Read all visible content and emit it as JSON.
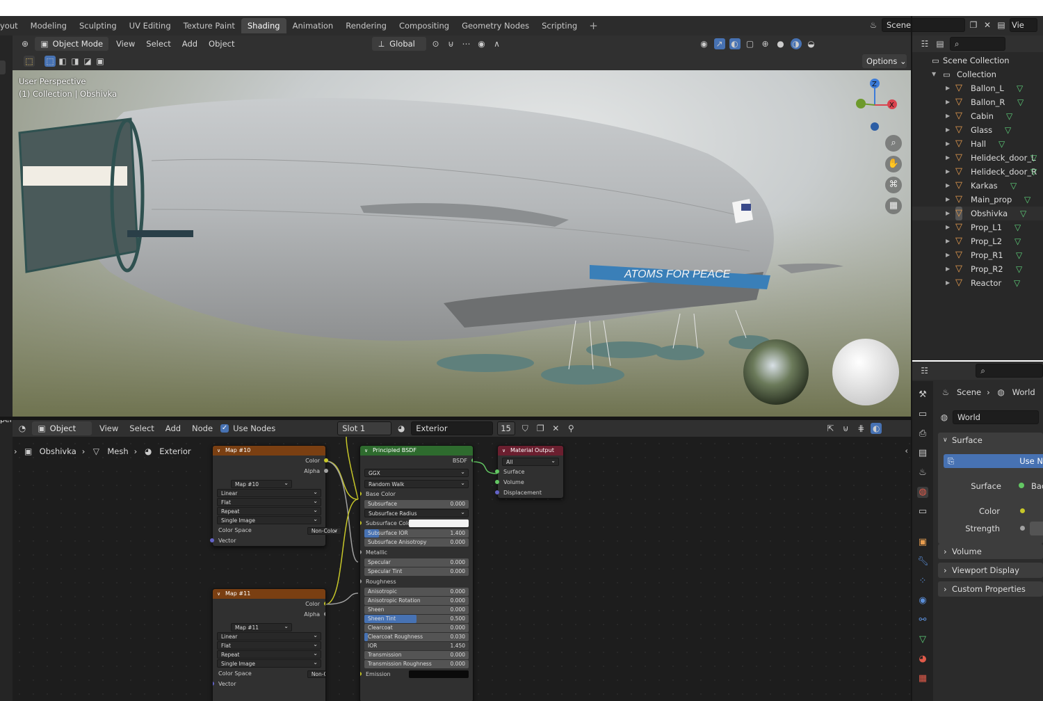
{
  "workspace_tabs": [
    "yout",
    "Modeling",
    "Sculpting",
    "UV Editing",
    "Texture Paint",
    "Shading",
    "Animation",
    "Rendering",
    "Compositing",
    "Geometry Nodes",
    "Scripting"
  ],
  "active_tab": "Shading",
  "scene": {
    "name": "Scene",
    "view_layer": "Vie"
  },
  "viewport": {
    "mode": "Object Mode",
    "menus": [
      "View",
      "Select",
      "Add",
      "Object"
    ],
    "transform_orientation": "Global",
    "options_label": "Options",
    "overlay_line1": "User Perspective",
    "overlay_line2": "(1) Collection | Obshivka",
    "gizmo": {
      "z": "Z",
      "x": "X"
    },
    "decal_text": "ATOMS FOR PEACE"
  },
  "node_editor": {
    "type": "Object",
    "menus": [
      "View",
      "Select",
      "Add",
      "Node"
    ],
    "use_nodes_label": "Use Nodes",
    "slot": "Slot 1",
    "material": "Exterior",
    "user_count": "15",
    "breadcrumb": [
      "Obshivka",
      "Mesh",
      "Exterior"
    ],
    "left_cut": "per"
  },
  "nodes": {
    "map10": {
      "title": "Map #10",
      "out_color": "Color",
      "out_alpha": "Alpha",
      "image": "Map #10",
      "interp": "Linear",
      "proj": "Flat",
      "ext": "Repeat",
      "source": "Single Image",
      "cs_label": "Color Space",
      "cs_value": "Non-Color",
      "in_vector": "Vector"
    },
    "map11": {
      "title": "Map #11",
      "out_color": "Color",
      "out_alpha": "Alpha",
      "image": "Map #11",
      "interp": "Linear",
      "proj": "Flat",
      "ext": "Repeat",
      "source": "Single Image",
      "cs_label": "Color Space",
      "cs_value": "Non-Color",
      "in_vector": "Vector"
    },
    "bsdf": {
      "title": "Principled BSDF",
      "out": "BSDF",
      "dist": "GGX",
      "sss_method": "Random Walk",
      "base_color": "Base Color",
      "subsurface": {
        "label": "Subsurface",
        "value": "0.000"
      },
      "subsurface_radius": "Subsurface Radius",
      "subsurface_color": "Subsurface Color",
      "subsurface_ior": {
        "label": "Subsurface IOR",
        "value": "1.400"
      },
      "subsurface_aniso": {
        "label": "Subsurface Anisotropy",
        "value": "0.000"
      },
      "metallic": "Metallic",
      "specular": {
        "label": "Specular",
        "value": "0.000"
      },
      "specular_tint": {
        "label": "Specular Tint",
        "value": "0.000"
      },
      "roughness": "Roughness",
      "anisotropic": {
        "label": "Anisotropic",
        "value": "0.000"
      },
      "aniso_rot": {
        "label": "Anisotropic Rotation",
        "value": "0.000"
      },
      "sheen": {
        "label": "Sheen",
        "value": "0.000"
      },
      "sheen_tint": {
        "label": "Sheen Tint",
        "value": "0.500",
        "fill": 0.5
      },
      "clearcoat": {
        "label": "Clearcoat",
        "value": "0.000"
      },
      "clearcoat_rough": {
        "label": "Clearcoat Roughness",
        "value": "0.030",
        "fill": 0.03
      },
      "ior": {
        "label": "IOR",
        "value": "1.450"
      },
      "transmission": {
        "label": "Transmission",
        "value": "0.000"
      },
      "transmission_rough": {
        "label": "Transmission Roughness",
        "value": "0.000"
      },
      "emission": "Emission"
    },
    "output": {
      "title": "Material Output",
      "target": "All",
      "surface": "Surface",
      "volume": "Volume",
      "displacement": "Displacement"
    }
  },
  "outliner": {
    "root": "Scene Collection",
    "collection": "Collection",
    "items": [
      "Ballon_L",
      "Ballon_R",
      "Cabin",
      "Glass",
      "Hall",
      "Helideck_door_L",
      "Helideck_door_R",
      "Karkas",
      "Main_prop",
      "Obshivka",
      "Prop_L1",
      "Prop_L2",
      "Prop_R1",
      "Prop_R2",
      "Reactor"
    ],
    "active_item": "Obshivka"
  },
  "properties": {
    "breadcrumb": [
      "Scene",
      "World"
    ],
    "world_name": "World",
    "surface_panel": "Surface",
    "use_nodes_btn": "Use N",
    "surface_label": "Surface",
    "surface_value": "Bac",
    "color_label": "Color",
    "strength_label": "Strength",
    "volume_panel": "Volume",
    "viewport_display_panel": "Viewport Display",
    "custom_props_panel": "Custom Properties"
  },
  "colors": {
    "texture_header": "#7a3f12",
    "shader_header": "#2e6b2e",
    "output_header": "#6b1f2f",
    "socket_color": "#c7c729",
    "socket_float": "#a1a1a1",
    "socket_vector": "#6363c7",
    "socket_shader": "#63c763",
    "accent": "#4772b3"
  }
}
